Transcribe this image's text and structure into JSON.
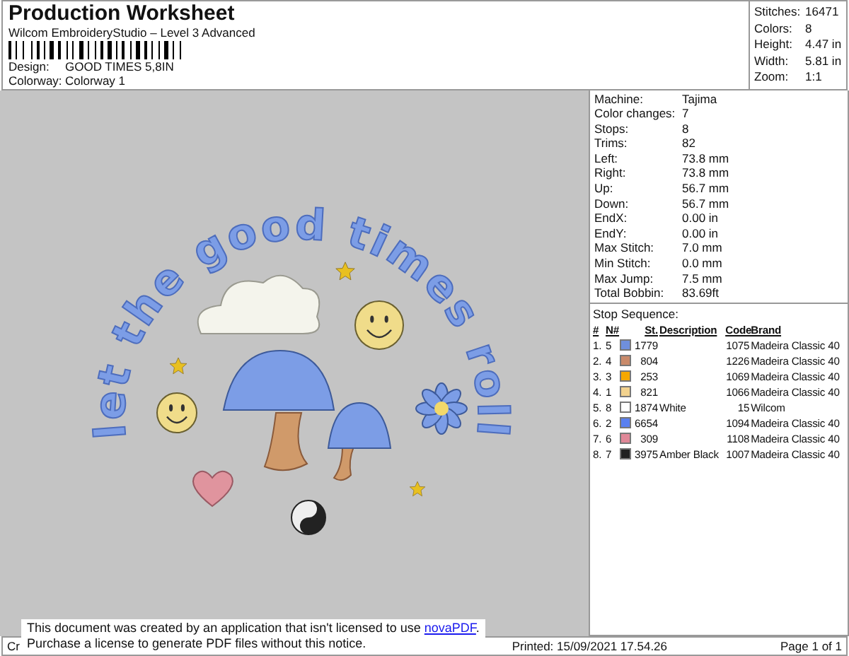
{
  "header": {
    "title": "Production Worksheet",
    "subtitle": "Wilcom EmbroideryStudio – Level 3 Advanced",
    "fields": [
      {
        "label": "Design:",
        "value": "GOOD TIMES 5,8IN"
      },
      {
        "label": "Colorway:",
        "value": "Colorway 1"
      }
    ]
  },
  "stats": [
    {
      "label": "Stitches:",
      "value": "16471"
    },
    {
      "label": "Colors:",
      "value": "8"
    },
    {
      "label": "Height:",
      "value": "4.47 in"
    },
    {
      "label": "Width:",
      "value": "5.81 in"
    },
    {
      "label": "Zoom:",
      "value": "1:1"
    }
  ],
  "design_preview": {
    "design_text": "let the good times roll"
  },
  "machine_info": [
    {
      "label": "Machine:",
      "value": "Tajima"
    },
    {
      "label": "Color changes:",
      "value": "7"
    },
    {
      "label": "Stops:",
      "value": "8"
    },
    {
      "label": "Trims:",
      "value": "82"
    },
    {
      "label": "Left:",
      "value": "73.8 mm"
    },
    {
      "label": "Right:",
      "value": "73.8 mm"
    },
    {
      "label": "Up:",
      "value": "56.7 mm"
    },
    {
      "label": "Down:",
      "value": "56.7 mm"
    },
    {
      "label": "EndX:",
      "value": "0.00 in"
    },
    {
      "label": "EndY:",
      "value": "0.00 in"
    },
    {
      "label": "Max Stitch:",
      "value": "7.0 mm"
    },
    {
      "label": "Min Stitch:",
      "value": "0.0 mm"
    },
    {
      "label": "Max Jump:",
      "value": "7.5 mm"
    },
    {
      "label": "Total Bobbin:",
      "value": "83.69ft"
    }
  ],
  "stop_sequence": {
    "title": "Stop Sequence:",
    "columns": [
      "#",
      "N#",
      "St.",
      "Description",
      "Code",
      "Brand"
    ],
    "rows": [
      {
        "index": "1.",
        "needle": "5",
        "color": "#6f8fdc",
        "st": "1779",
        "description": "",
        "code": "1075",
        "brand": "Madeira Classic 40"
      },
      {
        "index": "2.",
        "needle": "4",
        "color": "#c98a6a",
        "st": "804",
        "description": "",
        "code": "1226",
        "brand": "Madeira Classic 40"
      },
      {
        "index": "3.",
        "needle": "3",
        "color": "#f5a800",
        "st": "253",
        "description": "",
        "code": "1069",
        "brand": "Madeira Classic 40"
      },
      {
        "index": "4.",
        "needle": "1",
        "color": "#f2d28e",
        "st": "821",
        "description": "",
        "code": "1066",
        "brand": "Madeira Classic 40"
      },
      {
        "index": "5.",
        "needle": "8",
        "color": "#ffffff",
        "st": "1874",
        "description": "White",
        "code": "15",
        "brand": "Wilcom"
      },
      {
        "index": "6.",
        "needle": "2",
        "color": "#5a80f0",
        "st": "6654",
        "description": "",
        "code": "1094",
        "brand": "Madeira Classic 40"
      },
      {
        "index": "7.",
        "needle": "6",
        "color": "#e08898",
        "st": "309",
        "description": "",
        "code": "1108",
        "brand": "Madeira Classic 40"
      },
      {
        "index": "8.",
        "needle": "7",
        "color": "#222222",
        "st": "3975",
        "description": "Amber Black",
        "code": "1007",
        "brand": "Madeira Classic 40"
      }
    ]
  },
  "footer": {
    "left": "Cr",
    "printed": "Printed: 15/09/2021 17.54.26",
    "page": "Page 1 of 1"
  },
  "notice": {
    "before_link": "This document was created by an application that isn't licensed to use ",
    "link": "novaPDF",
    "after_link": ".",
    "line_2": "Purchase a license to generate PDF files without this notice."
  }
}
